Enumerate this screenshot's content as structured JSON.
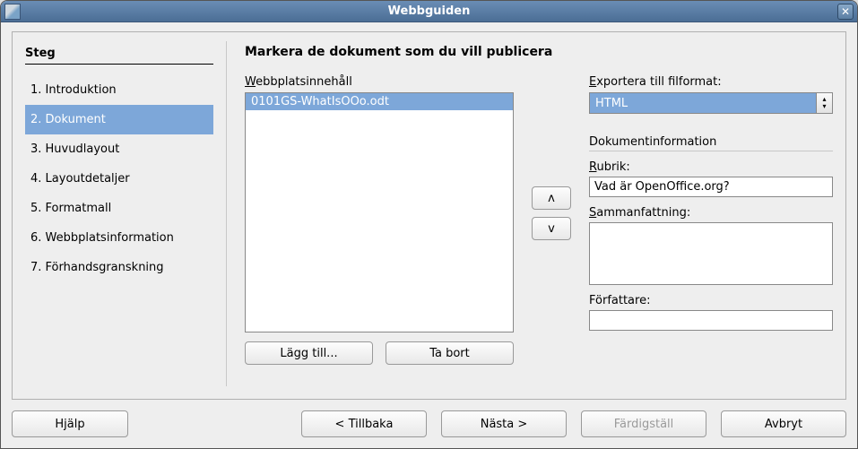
{
  "window": {
    "title": "Webbguiden"
  },
  "sidebar": {
    "heading": "Steg",
    "items": [
      {
        "label": "1. Introduktion"
      },
      {
        "label": "2. Dokument",
        "selected": true
      },
      {
        "label": "3. Huvudlayout"
      },
      {
        "label": "4. Layoutdetaljer"
      },
      {
        "label": "5. Formatmall"
      },
      {
        "label": "6. Webbplatsinformation"
      },
      {
        "label": "7. Förhandsgranskning"
      }
    ]
  },
  "content": {
    "heading": "Markera de dokument som du vill publicera",
    "list_label": "Webbplatsinnehåll",
    "list_items": [
      {
        "label": "0101GS-WhatIsOOo.odt",
        "selected": true
      }
    ],
    "add_label": "Lägg till...",
    "remove_label": "Ta bort",
    "move_up": "ʌ",
    "move_down": "v",
    "export_label": "Exportera till filformat:",
    "export_value": "HTML",
    "docinfo_heading": "Dokumentinformation",
    "rubrik_label": "Rubrik:",
    "rubrik_value": "Vad är OpenOffice.org?",
    "summary_label": "Sammanfattning:",
    "summary_value": "",
    "author_label": "Författare:",
    "author_value": ""
  },
  "footer": {
    "help": "Hjälp",
    "back": "< Tillbaka",
    "next": "Nästa >",
    "finish": "Färdigställ",
    "cancel": "Avbryt"
  }
}
